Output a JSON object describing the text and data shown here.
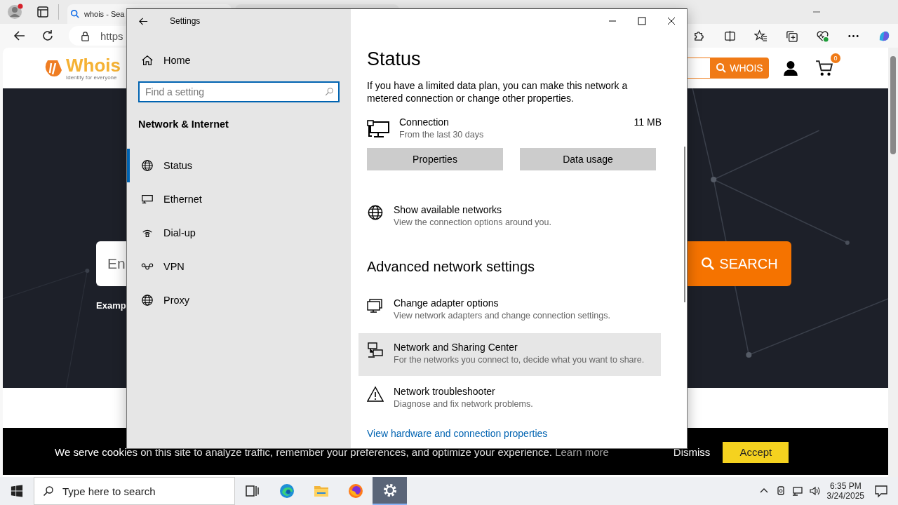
{
  "browser": {
    "tabs": [
      {
        "title": "whois - Sea",
        "selected": true
      },
      {
        "selected": false
      }
    ],
    "address": "https"
  },
  "site": {
    "logo": "Whois",
    "tagline": "Identity for everyone",
    "whois_button": "WHOIS",
    "cart_count": "0",
    "search_placeholder": "En",
    "search_button": "SEARCH",
    "example": "Examp"
  },
  "cookie_bar": {
    "text": "We serve cookies on this site to analyze traffic, remember your preferences, and optimize your experience.",
    "link": "Learn more",
    "dismiss": "Dismiss",
    "accept": "Accept"
  },
  "settings": {
    "title": "Settings",
    "home": "Home",
    "search_placeholder": "Find a setting",
    "section": "Network & Internet",
    "nav": [
      {
        "label": "Status",
        "kind": "globe",
        "selected": true
      },
      {
        "label": "Ethernet",
        "kind": "ethernet",
        "selected": false
      },
      {
        "label": "Dial-up",
        "kind": "dialup",
        "selected": false
      },
      {
        "label": "VPN",
        "kind": "vpn",
        "selected": false
      },
      {
        "label": "Proxy",
        "kind": "globe",
        "selected": false
      }
    ],
    "heading": "Status",
    "intro": "If you have a limited data plan, you can make this network a metered connection or change other properties.",
    "connection": {
      "name": "Connection",
      "period": "From the last 30 days",
      "usage": "11 MB"
    },
    "buttons": [
      "Properties",
      "Data usage"
    ],
    "available": {
      "title": "Show available networks",
      "description": "View the connection options around you.",
      "kind": "globe"
    },
    "advanced_heading": "Advanced network settings",
    "links": [
      {
        "title": "Change adapter options",
        "description": "View network adapters and change connection settings.",
        "kind": "adapter",
        "hovered": false
      },
      {
        "title": "Network and Sharing Center",
        "description": "For the networks you connect to, decide what you want to share.",
        "kind": "sharing",
        "hovered": true
      },
      {
        "title": "Network troubleshooter",
        "description": "Diagnose and fix network problems.",
        "kind": "warning",
        "hovered": false
      }
    ],
    "hardware_link": "View hardware and connection properties"
  },
  "taskbar": {
    "search_placeholder": "Type here to search",
    "apps": [
      {
        "kind": "taskview",
        "active": false
      },
      {
        "kind": "edge",
        "active": false
      },
      {
        "kind": "explorer",
        "active": false
      },
      {
        "kind": "firefox",
        "active": false
      },
      {
        "kind": "settings",
        "active": true
      }
    ],
    "time": "6:35 PM",
    "date": "3/24/2025"
  }
}
